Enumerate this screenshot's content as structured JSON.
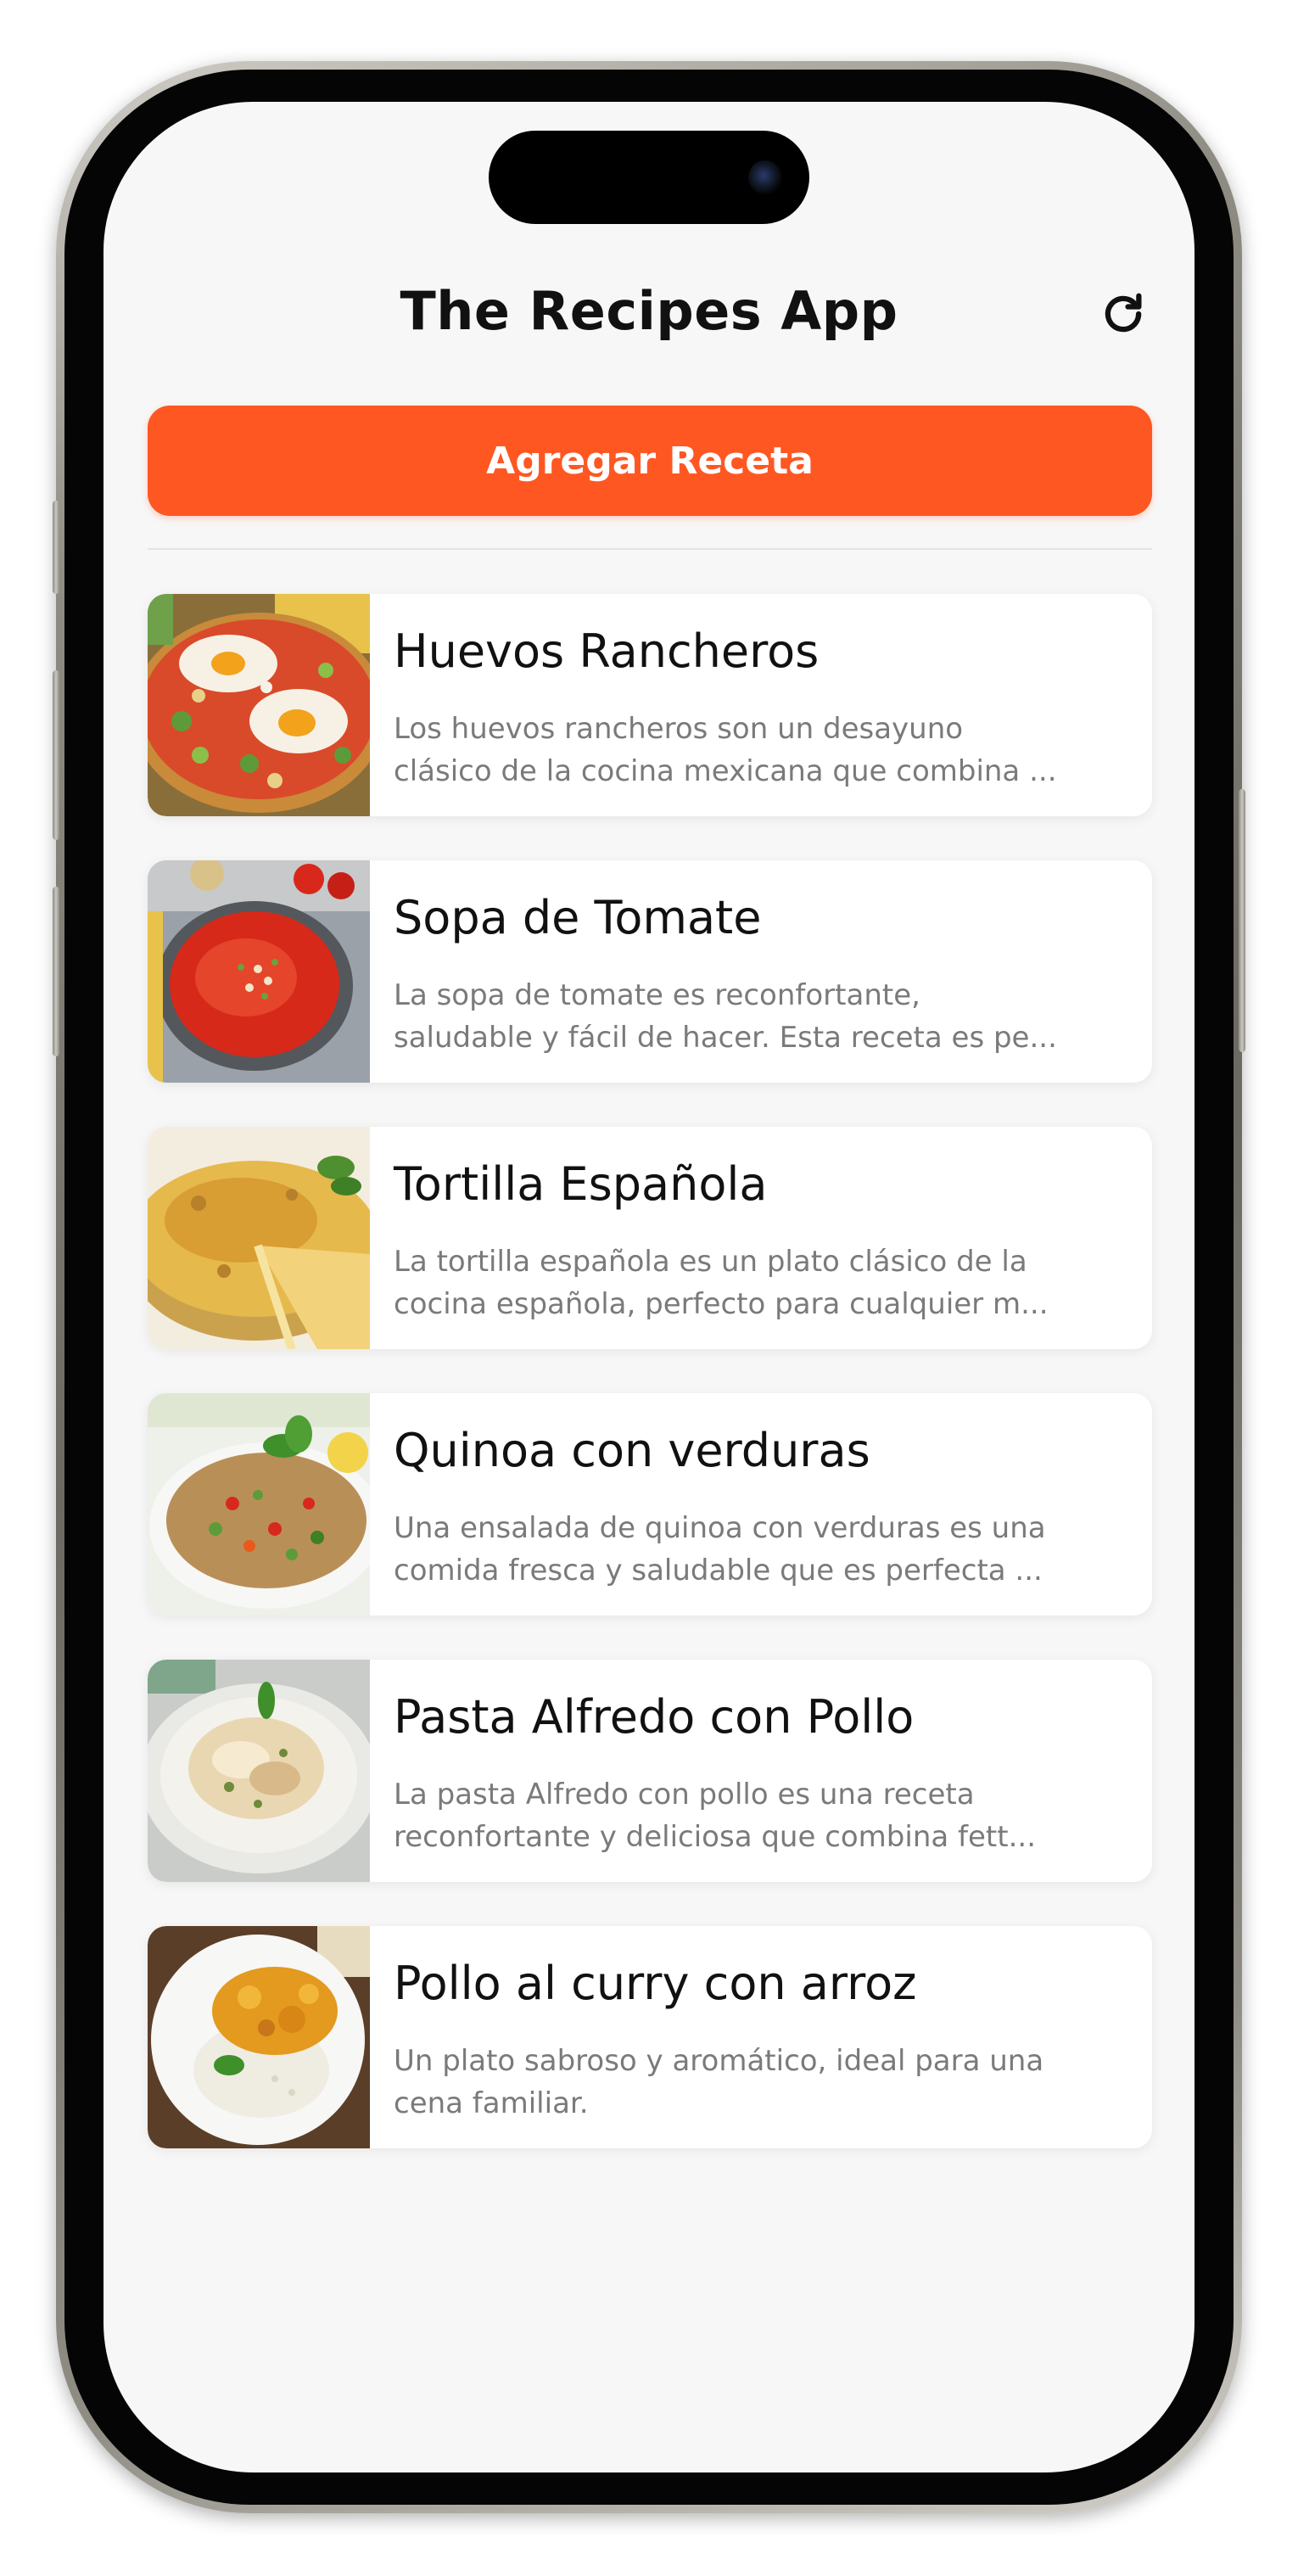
{
  "header": {
    "title": "The Recipes App",
    "refresh_icon": "refresh-icon"
  },
  "actions": {
    "add_recipe_label": "Agregar Receta"
  },
  "colors": {
    "accent": "#ff5722",
    "background": "#f7f7f7",
    "card": "#ffffff",
    "title_text": "#111111",
    "description_text": "#7a7a7a"
  },
  "recipes": [
    {
      "name": "Huevos Rancheros",
      "description_lines": [
        "Los huevos rancheros son un desayuno",
        "clásico de la cocina mexicana que combina ..."
      ]
    },
    {
      "name": "Sopa de Tomate",
      "description_lines": [
        "La sopa de tomate es reconfortante,",
        "saludable y fácil de hacer. Esta receta es pe..."
      ]
    },
    {
      "name": "Tortilla Española",
      "description_lines": [
        "La tortilla española es un plato clásico de la",
        "cocina española, perfecto para cualquier m..."
      ]
    },
    {
      "name": "Quinoa con verduras",
      "description_lines": [
        "Una ensalada de quinoa con verduras es una",
        "comida fresca y saludable que es perfecta ..."
      ]
    },
    {
      "name": "Pasta Alfredo con Pollo",
      "description_lines": [
        "La pasta Alfredo con pollo es una receta",
        "reconfortante y deliciosa que combina fett..."
      ]
    },
    {
      "name": "Pollo al curry con arroz",
      "description_lines": [
        "Un plato sabroso y aromático, ideal para una",
        "cena familiar."
      ]
    }
  ]
}
